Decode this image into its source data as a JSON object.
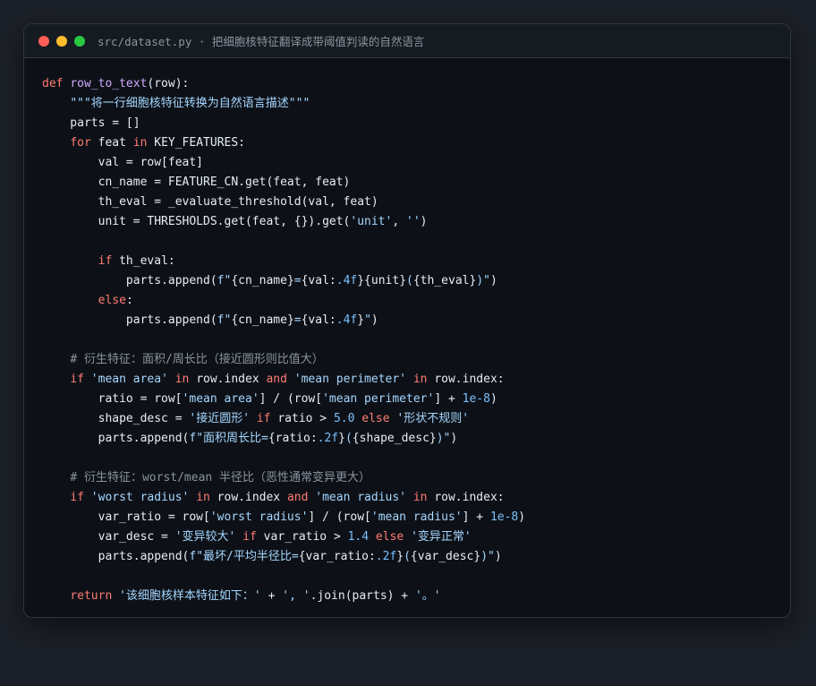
{
  "window": {
    "title": "src/dataset.py · 把细胞核特征翻译成带阈值判读的自然语言",
    "colors": {
      "background": "#0d1117",
      "keyword": "#ff7b72",
      "function": "#d2a8ff",
      "string": "#a5d6ff",
      "number": "#79c0ff",
      "comment": "#8b949e"
    }
  },
  "code": {
    "lines": [
      [
        {
          "t": "kw",
          "v": "def "
        },
        {
          "t": "fn",
          "v": "row_to_text"
        },
        {
          "t": "",
          "v": "(row):"
        }
      ],
      [
        {
          "t": "",
          "v": "    "
        },
        {
          "t": "doc",
          "v": "\"\"\"将一行细胞核特征转换为自然语言描述\"\"\""
        }
      ],
      [
        {
          "t": "",
          "v": "    parts = []"
        }
      ],
      [
        {
          "t": "",
          "v": "    "
        },
        {
          "t": "kw",
          "v": "for"
        },
        {
          "t": "",
          "v": " feat "
        },
        {
          "t": "kw",
          "v": "in"
        },
        {
          "t": "",
          "v": " KEY_FEATURES:"
        }
      ],
      [
        {
          "t": "",
          "v": "        val = row[feat]"
        }
      ],
      [
        {
          "t": "",
          "v": "        cn_name = FEATURE_CN.get(feat, feat)"
        }
      ],
      [
        {
          "t": "",
          "v": "        th_eval = _evaluate_threshold(val, feat)"
        }
      ],
      [
        {
          "t": "",
          "v": "        unit = THRESHOLDS.get(feat, {}).get("
        },
        {
          "t": "str",
          "v": "'unit'"
        },
        {
          "t": "",
          "v": ", "
        },
        {
          "t": "str",
          "v": "''"
        },
        {
          "t": "",
          "v": ")"
        }
      ],
      [],
      [
        {
          "t": "",
          "v": "        "
        },
        {
          "t": "kw",
          "v": "if"
        },
        {
          "t": "",
          "v": " th_eval:"
        }
      ],
      [
        {
          "t": "",
          "v": "            parts.append("
        },
        {
          "t": "str",
          "v": "f\""
        },
        {
          "t": "",
          "v": "{cn_name}"
        },
        {
          "t": "str",
          "v": "="
        },
        {
          "t": "",
          "v": "{val:"
        },
        {
          "t": "num",
          "v": ".4f"
        },
        {
          "t": "",
          "v": "}{unit}"
        },
        {
          "t": "str",
          "v": "("
        },
        {
          "t": "",
          "v": "{th_eval}"
        },
        {
          "t": "str",
          "v": ")\""
        },
        {
          "t": "",
          "v": ")"
        }
      ],
      [
        {
          "t": "",
          "v": "        "
        },
        {
          "t": "kw",
          "v": "else"
        },
        {
          "t": "",
          "v": ":"
        }
      ],
      [
        {
          "t": "",
          "v": "            parts.append("
        },
        {
          "t": "str",
          "v": "f\""
        },
        {
          "t": "",
          "v": "{cn_name}"
        },
        {
          "t": "str",
          "v": "="
        },
        {
          "t": "",
          "v": "{val:"
        },
        {
          "t": "num",
          "v": ".4f"
        },
        {
          "t": "",
          "v": "}"
        },
        {
          "t": "str",
          "v": "\""
        },
        {
          "t": "",
          "v": ")"
        }
      ],
      [],
      [
        {
          "t": "",
          "v": "    "
        },
        {
          "t": "cm",
          "v": "# 衍生特征：面积/周长比（接近圆形则比值大）"
        }
      ],
      [
        {
          "t": "",
          "v": "    "
        },
        {
          "t": "kw",
          "v": "if"
        },
        {
          "t": "",
          "v": " "
        },
        {
          "t": "str",
          "v": "'mean area'"
        },
        {
          "t": "",
          "v": " "
        },
        {
          "t": "kw",
          "v": "in"
        },
        {
          "t": "",
          "v": " row.index "
        },
        {
          "t": "kw",
          "v": "and"
        },
        {
          "t": "",
          "v": " "
        },
        {
          "t": "str",
          "v": "'mean perimeter'"
        },
        {
          "t": "",
          "v": " "
        },
        {
          "t": "kw",
          "v": "in"
        },
        {
          "t": "",
          "v": " row.index:"
        }
      ],
      [
        {
          "t": "",
          "v": "        ratio = row["
        },
        {
          "t": "str",
          "v": "'mean area'"
        },
        {
          "t": "",
          "v": "] / (row["
        },
        {
          "t": "str",
          "v": "'mean perimeter'"
        },
        {
          "t": "",
          "v": "] + "
        },
        {
          "t": "num",
          "v": "1e-8"
        },
        {
          "t": "",
          "v": ")"
        }
      ],
      [
        {
          "t": "",
          "v": "        shape_desc = "
        },
        {
          "t": "str",
          "v": "'接近圆形'"
        },
        {
          "t": "",
          "v": " "
        },
        {
          "t": "kw",
          "v": "if"
        },
        {
          "t": "",
          "v": " ratio > "
        },
        {
          "t": "num",
          "v": "5.0"
        },
        {
          "t": "",
          "v": " "
        },
        {
          "t": "kw",
          "v": "else"
        },
        {
          "t": "",
          "v": " "
        },
        {
          "t": "str",
          "v": "'形状不规则'"
        }
      ],
      [
        {
          "t": "",
          "v": "        parts.append("
        },
        {
          "t": "str",
          "v": "f\"面积周长比="
        },
        {
          "t": "",
          "v": "{ratio:"
        },
        {
          "t": "num",
          "v": ".2f"
        },
        {
          "t": "",
          "v": "}"
        },
        {
          "t": "str",
          "v": "("
        },
        {
          "t": "",
          "v": "{shape_desc}"
        },
        {
          "t": "str",
          "v": ")\""
        },
        {
          "t": "",
          "v": ")"
        }
      ],
      [],
      [
        {
          "t": "",
          "v": "    "
        },
        {
          "t": "cm",
          "v": "# 衍生特征：worst/mean 半径比（恶性通常变异更大）"
        }
      ],
      [
        {
          "t": "",
          "v": "    "
        },
        {
          "t": "kw",
          "v": "if"
        },
        {
          "t": "",
          "v": " "
        },
        {
          "t": "str",
          "v": "'worst radius'"
        },
        {
          "t": "",
          "v": " "
        },
        {
          "t": "kw",
          "v": "in"
        },
        {
          "t": "",
          "v": " row.index "
        },
        {
          "t": "kw",
          "v": "and"
        },
        {
          "t": "",
          "v": " "
        },
        {
          "t": "str",
          "v": "'mean radius'"
        },
        {
          "t": "",
          "v": " "
        },
        {
          "t": "kw",
          "v": "in"
        },
        {
          "t": "",
          "v": " row.index:"
        }
      ],
      [
        {
          "t": "",
          "v": "        var_ratio = row["
        },
        {
          "t": "str",
          "v": "'worst radius'"
        },
        {
          "t": "",
          "v": "] / (row["
        },
        {
          "t": "str",
          "v": "'mean radius'"
        },
        {
          "t": "",
          "v": "] + "
        },
        {
          "t": "num",
          "v": "1e-8"
        },
        {
          "t": "",
          "v": ")"
        }
      ],
      [
        {
          "t": "",
          "v": "        var_desc = "
        },
        {
          "t": "str",
          "v": "'变异较大'"
        },
        {
          "t": "",
          "v": " "
        },
        {
          "t": "kw",
          "v": "if"
        },
        {
          "t": "",
          "v": " var_ratio > "
        },
        {
          "t": "num",
          "v": "1.4"
        },
        {
          "t": "",
          "v": " "
        },
        {
          "t": "kw",
          "v": "else"
        },
        {
          "t": "",
          "v": " "
        },
        {
          "t": "str",
          "v": "'变异正常'"
        }
      ],
      [
        {
          "t": "",
          "v": "        parts.append("
        },
        {
          "t": "str",
          "v": "f\"最坏/平均半径比="
        },
        {
          "t": "",
          "v": "{var_ratio:"
        },
        {
          "t": "num",
          "v": ".2f"
        },
        {
          "t": "",
          "v": "}"
        },
        {
          "t": "str",
          "v": "("
        },
        {
          "t": "",
          "v": "{var_desc}"
        },
        {
          "t": "str",
          "v": ")\""
        },
        {
          "t": "",
          "v": ")"
        }
      ],
      [],
      [
        {
          "t": "",
          "v": "    "
        },
        {
          "t": "kw",
          "v": "return"
        },
        {
          "t": "",
          "v": " "
        },
        {
          "t": "str",
          "v": "'该细胞核样本特征如下：'"
        },
        {
          "t": "",
          "v": " + "
        },
        {
          "t": "str",
          "v": "', '"
        },
        {
          "t": "",
          "v": ".join(parts) + "
        },
        {
          "t": "str",
          "v": "'。'"
        }
      ]
    ]
  }
}
